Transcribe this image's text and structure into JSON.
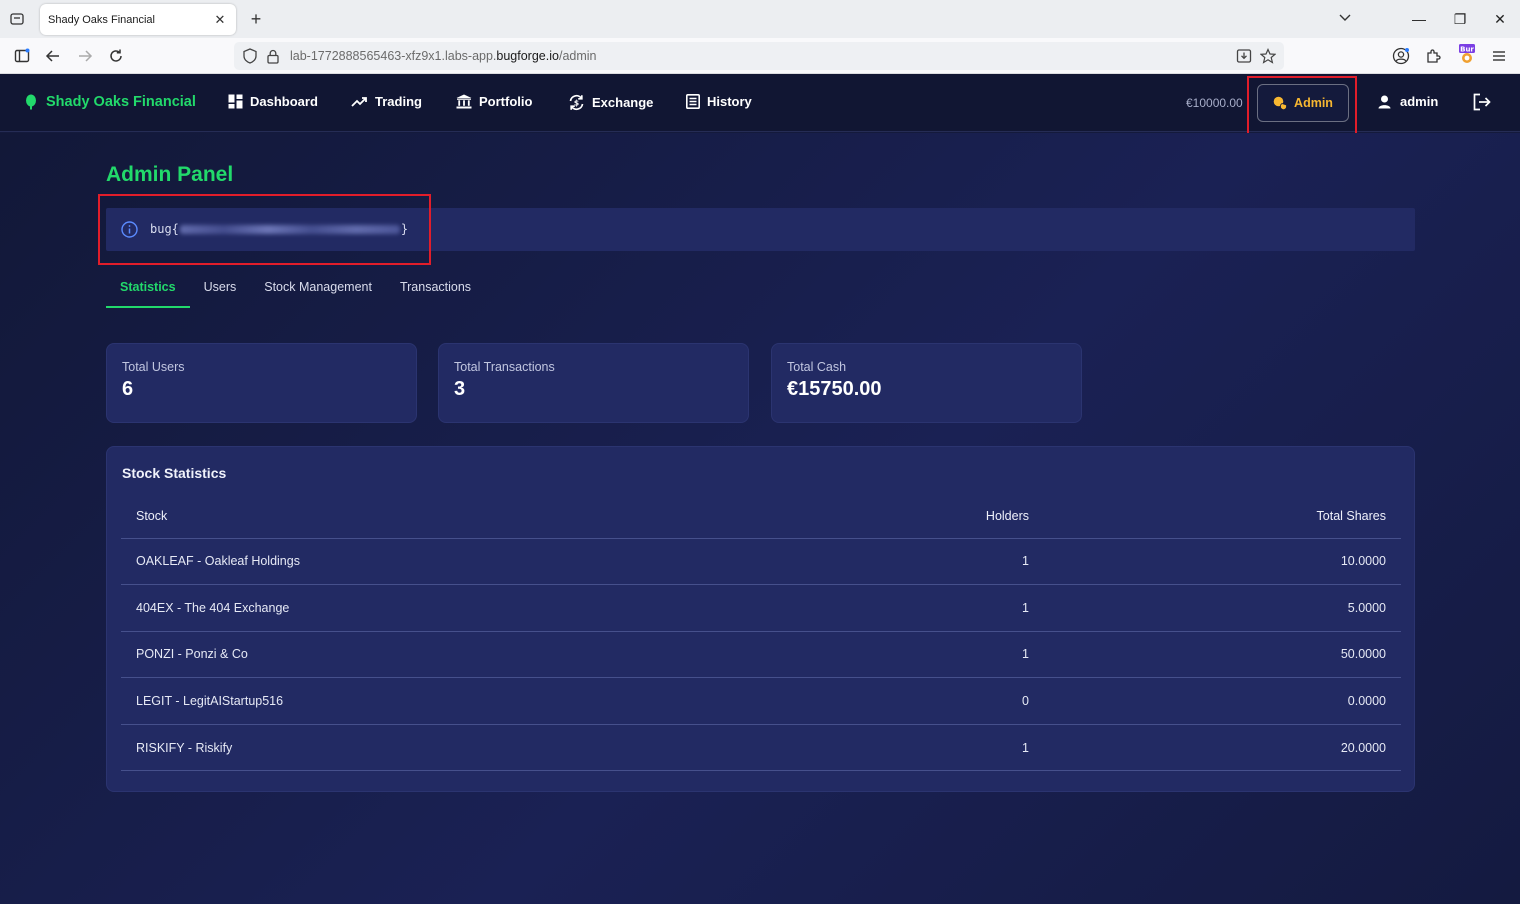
{
  "browser": {
    "tab_title": "Shady Oaks Financial",
    "url_prefix": "lab-1772888565463-xfz9x1.labs-app.",
    "url_host": "bugforge.io",
    "url_path": "/admin"
  },
  "nav": {
    "brand": "Shady Oaks Financial",
    "links": [
      "Dashboard",
      "Trading",
      "Portfolio",
      "Exchange",
      "History"
    ],
    "balance": "€10000.00",
    "admin_label": "Admin",
    "user_label": "admin"
  },
  "page": {
    "title": "Admin Panel",
    "flag_prefix": "bug{",
    "flag_suffix": "}"
  },
  "tabs": [
    "Statistics",
    "Users",
    "Stock Management",
    "Transactions"
  ],
  "stats": [
    {
      "label": "Total Users",
      "value": "6"
    },
    {
      "label": "Total Transactions",
      "value": "3"
    },
    {
      "label": "Total Cash",
      "value": "€15750.00"
    }
  ],
  "stock_stats": {
    "title": "Stock Statistics",
    "columns": [
      "Stock",
      "Holders",
      "Total Shares"
    ],
    "rows": [
      {
        "stock": "OAKLEAF - Oakleaf Holdings",
        "holders": "1",
        "shares": "10.0000"
      },
      {
        "stock": "404EX - The 404 Exchange",
        "holders": "1",
        "shares": "5.0000"
      },
      {
        "stock": "PONZI - Ponzi & Co",
        "holders": "1",
        "shares": "50.0000"
      },
      {
        "stock": "LEGIT - LegitAIStartup516",
        "holders": "0",
        "shares": "0.0000"
      },
      {
        "stock": "RISKIFY - Riskify",
        "holders": "1",
        "shares": "20.0000"
      }
    ]
  },
  "colors": {
    "accent_green": "#22d96b",
    "admin_yellow": "#f7b731",
    "highlight_red": "#e11d2a",
    "panel_bg": "#222a63"
  }
}
